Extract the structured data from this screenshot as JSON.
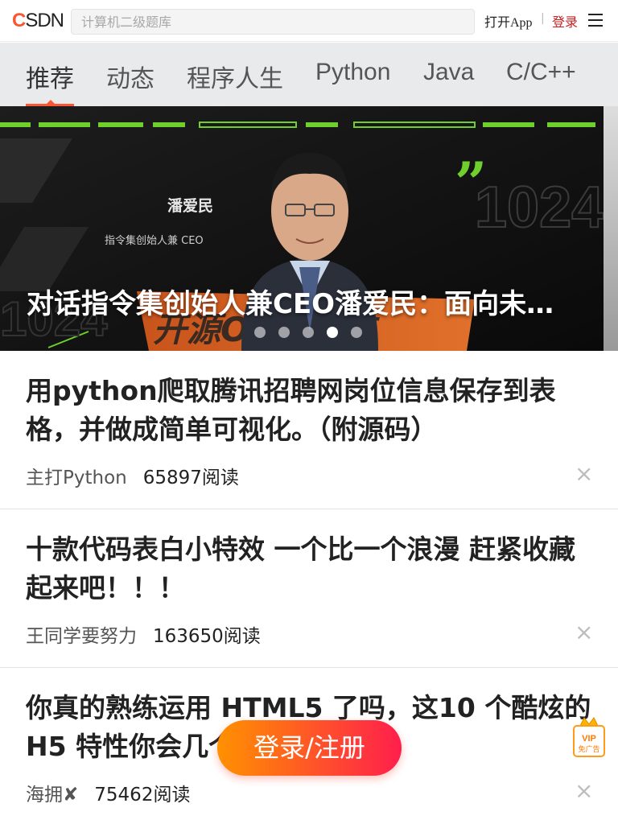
{
  "topbar": {
    "logo_c": "C",
    "logo_rest": "SDN",
    "search_placeholder": "计算机二级题库",
    "open_app": "打开App",
    "separator": "|",
    "login": "登录"
  },
  "tabs": [
    "推荐",
    "动态",
    "程序人生",
    "Python",
    "Java",
    "C/C++"
  ],
  "banner": {
    "title": "对话指令集创始人兼CEO潘爱民：面向未…",
    "person_name": "潘爱民",
    "person_role": "指令集创始人兼 CEO",
    "bg_text": "开源OS人物志",
    "watermark": "1024",
    "slides": 5,
    "active_slide": 4
  },
  "articles": [
    {
      "title": "用python爬取腾讯招聘网岗位信息保存到表格，并做成简单可视化。（附源码）",
      "author": "主打Python",
      "reads": "65897阅读"
    },
    {
      "title": "十款代码表白小特效 一个比一个浪漫 赶紧收藏起来吧！！！",
      "author": "王同学要努力",
      "reads": "163650阅读"
    },
    {
      "title": "你真的熟练运用 HTML5 了吗，这10 个酷炫的 H5 特性你会几个？",
      "author": "海拥✘",
      "reads": "75462阅读"
    }
  ],
  "close_glyph": "×",
  "floating": {
    "login_register": "登录/注册",
    "vip_line1": "VIP",
    "vip_line2": "免广告"
  },
  "colors": {
    "brand": "#fc5531",
    "login_red": "#c81d1d",
    "tab_bg": "#e9eaec",
    "float_from": "#ff9100",
    "float_to": "#ff1e4c"
  }
}
